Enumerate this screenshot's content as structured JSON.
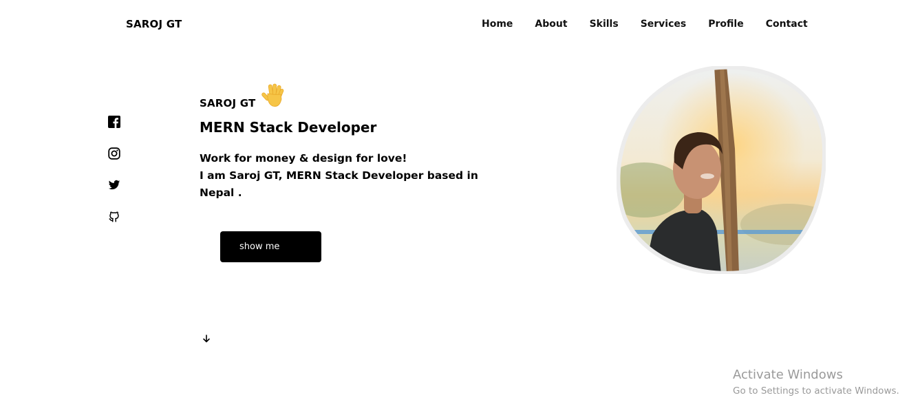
{
  "header": {
    "logo": "SAROJ GT",
    "nav": [
      "Home",
      "About",
      "Skills",
      "Services",
      "Profile",
      "Contact"
    ]
  },
  "social": [
    {
      "icon": "facebook-icon"
    },
    {
      "icon": "instagram-icon"
    },
    {
      "icon": "twitter-icon"
    },
    {
      "icon": "github-icon"
    }
  ],
  "hero": {
    "name": "SAROJ GT",
    "wave_icon": "waving-hand-icon",
    "title": "MERN Stack Developer",
    "desc_lines": [
      "Work for money & design for love!",
      "I am Saroj GT, MERN Stack Developer based in",
      "Nepal ."
    ],
    "cta_label": "show me",
    "scroll_icon": "arrow-down-icon"
  },
  "profile_image": "profile-photo",
  "watermark": {
    "title": "Activate Windows",
    "subtitle": "Go to Settings to activate Windows."
  },
  "colors": {
    "text": "#111111",
    "button_bg": "#000000",
    "button_text": "#ffffff",
    "wave": "#f6c547",
    "watermark": "#9a9a9a"
  }
}
